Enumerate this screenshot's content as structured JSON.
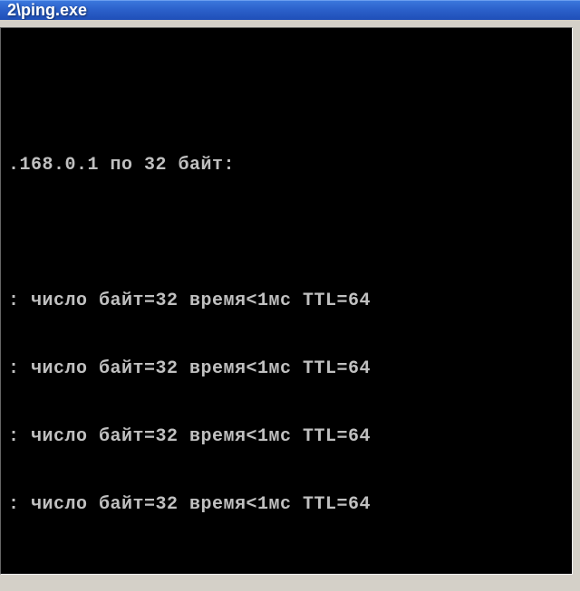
{
  "titlebar": {
    "path_fragment": "2\\ping.exe"
  },
  "console": {
    "header_fragment": ".168.0.1 по 32 байт:",
    "reply_lines": [
      ": число байт=32 время<1мс TTL=64",
      ": число байт=32 время<1мс TTL=64",
      ": число байт=32 время<1мс TTL=64",
      ": число байт=32 время<1мс TTL=64"
    ]
  }
}
